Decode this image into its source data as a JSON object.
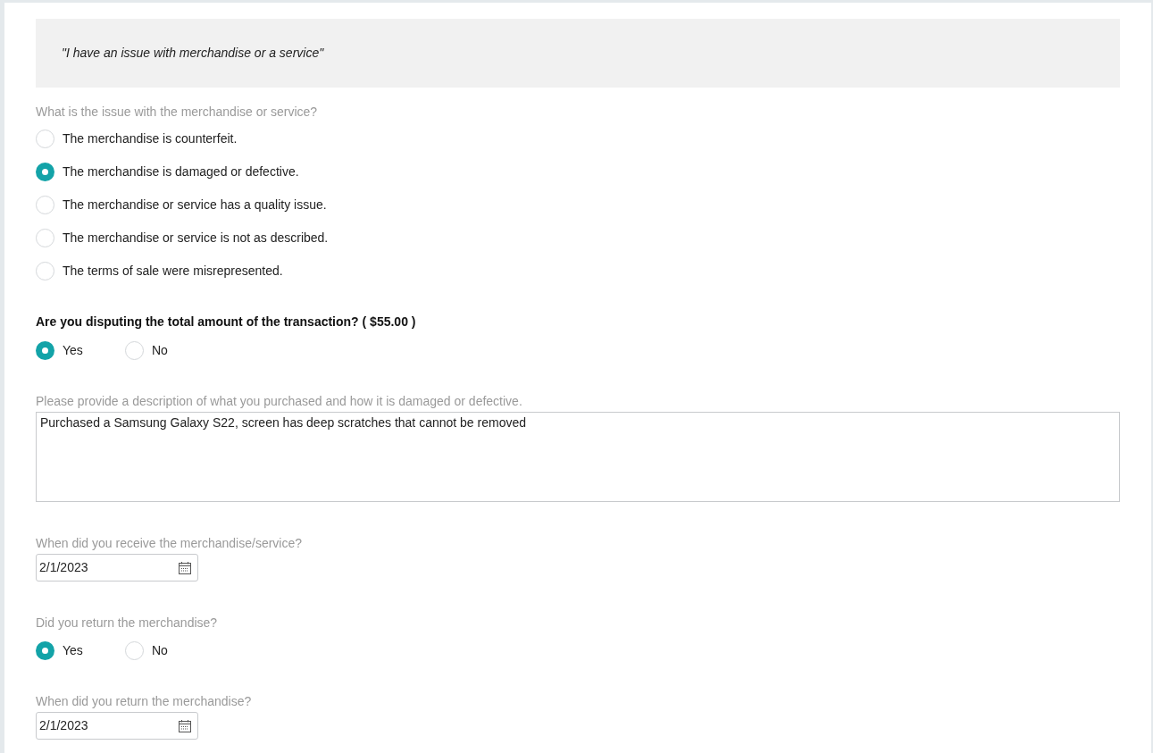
{
  "banner": {
    "text": "\"I have an issue with merchandise or a service\""
  },
  "sections": [
    {
      "kind": "radio_list",
      "strong": false,
      "label": "What is the issue with the merchandise or service?",
      "options": [
        {
          "label": "The merchandise is counterfeit.",
          "selected": false
        },
        {
          "label": "The merchandise is damaged or defective.",
          "selected": true
        },
        {
          "label": "The merchandise or service has a quality issue.",
          "selected": false
        },
        {
          "label": "The merchandise or service is not as described.",
          "selected": false
        },
        {
          "label": "The terms of sale were misrepresented.",
          "selected": false
        }
      ]
    },
    {
      "kind": "inline_radio",
      "strong": true,
      "label": "Are you disputing the total amount of the transaction? ( $55.00 )",
      "options": [
        {
          "label": "Yes",
          "selected": true
        },
        {
          "label": "No",
          "selected": false
        }
      ]
    },
    {
      "kind": "textarea",
      "strong": false,
      "label": "Please provide a description of what you purchased and how it is damaged or defective.",
      "value": "Purchased a Samsung Galaxy S22, screen has deep scratches that cannot be removed"
    },
    {
      "kind": "date",
      "strong": false,
      "label": "When did you receive the merchandise/service?",
      "value": "2/1/2023"
    },
    {
      "kind": "inline_radio",
      "strong": false,
      "label": "Did you return the merchandise?",
      "options": [
        {
          "label": "Yes",
          "selected": true
        },
        {
          "label": "No",
          "selected": false
        }
      ]
    },
    {
      "kind": "date",
      "strong": false,
      "label": "When did you return the merchandise?",
      "value": "2/1/2023"
    }
  ]
}
